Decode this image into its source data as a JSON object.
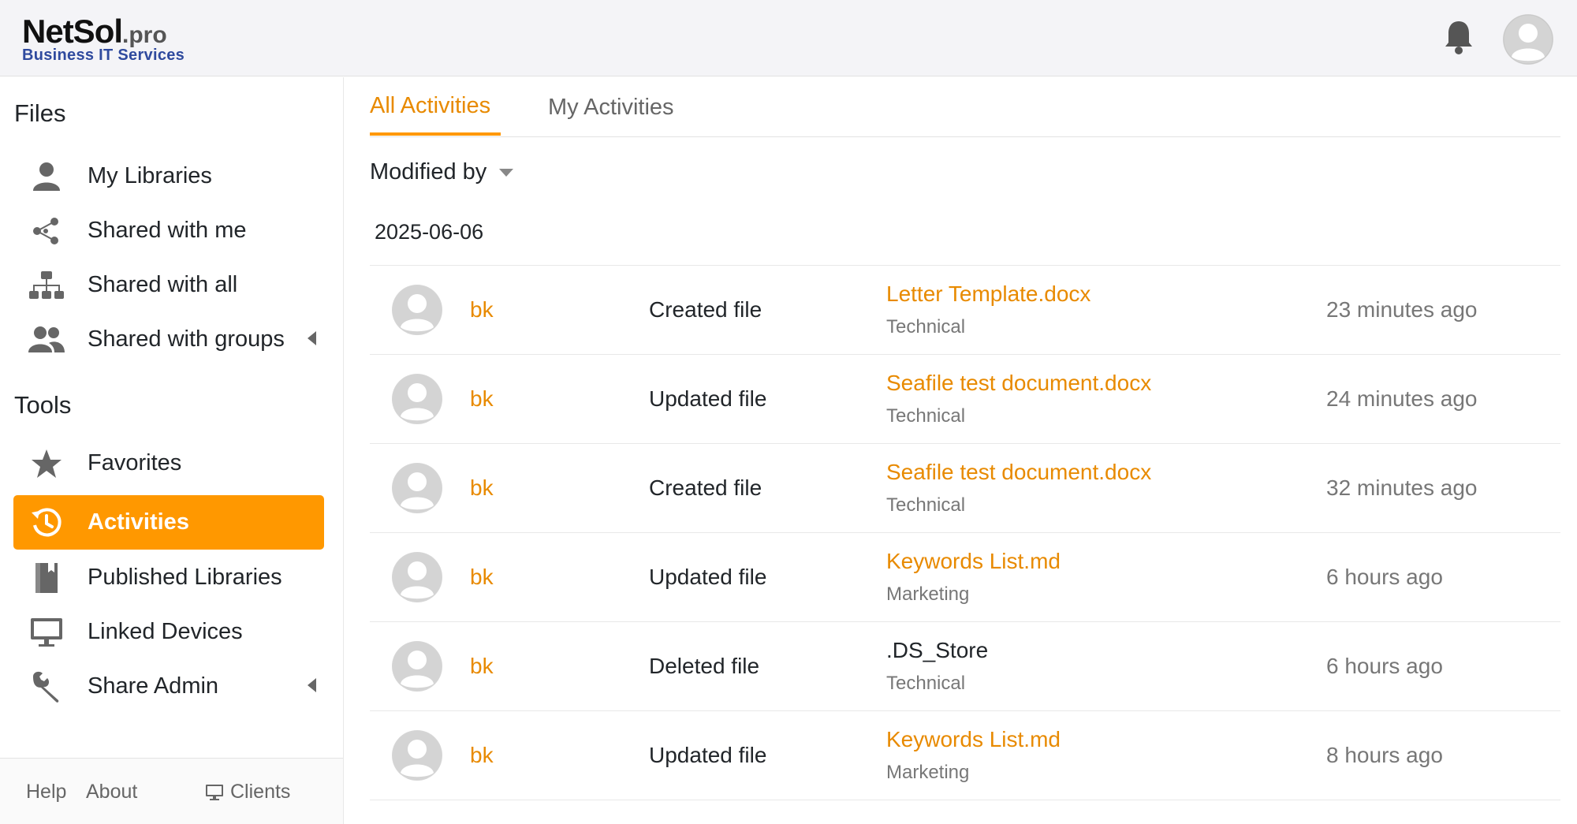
{
  "header": {
    "logo_main": "NetSol",
    "logo_suffix": ".pro",
    "logo_sub": "Business IT Services",
    "notification_icon": "bell-icon",
    "avatar_icon": "user-avatar-icon"
  },
  "sidebar": {
    "files_title": "Files",
    "files_items": [
      {
        "label": "My Libraries",
        "icon": "user-icon"
      },
      {
        "label": "Shared with me",
        "icon": "share-icon"
      },
      {
        "label": "Shared with all",
        "icon": "org-chart-icon"
      },
      {
        "label": "Shared with groups",
        "icon": "group-icon"
      }
    ],
    "tools_title": "Tools",
    "tools_items": [
      {
        "label": "Favorites",
        "icon": "star-icon"
      },
      {
        "label": "Activities",
        "icon": "history-icon"
      },
      {
        "label": "Published Libraries",
        "icon": "book-icon"
      },
      {
        "label": "Linked Devices",
        "icon": "monitor-icon"
      },
      {
        "label": "Share Admin",
        "icon": "wrench-icon"
      }
    ],
    "footer": {
      "help": "Help",
      "about": "About",
      "clients": "Clients"
    }
  },
  "main": {
    "tabs": [
      {
        "label": "All Activities",
        "active": true
      },
      {
        "label": "My Activities",
        "active": false
      }
    ],
    "filter_label": "Modified by",
    "date": "2025-06-06",
    "rows": [
      {
        "user": "bk",
        "op": "Created file",
        "file": "Letter Template.docx",
        "library": "Technical",
        "time": "23 minutes ago",
        "linked": true
      },
      {
        "user": "bk",
        "op": "Updated file",
        "file": "Seafile test document.docx",
        "library": "Technical",
        "time": "24 minutes ago",
        "linked": true
      },
      {
        "user": "bk",
        "op": "Created file",
        "file": "Seafile test document.docx",
        "library": "Technical",
        "time": "32 minutes ago",
        "linked": true
      },
      {
        "user": "bk",
        "op": "Updated file",
        "file": "Keywords List.md",
        "library": "Marketing",
        "time": "6 hours ago",
        "linked": true
      },
      {
        "user": "bk",
        "op": "Deleted file",
        "file": ".DS_Store",
        "library": "Technical",
        "time": "6 hours ago",
        "linked": false
      },
      {
        "user": "bk",
        "op": "Updated file",
        "file": "Keywords List.md",
        "library": "Marketing",
        "time": "8 hours ago",
        "linked": true
      }
    ]
  },
  "colors": {
    "accent": "#ff9800",
    "link": "#e88a00",
    "muted": "#777777"
  }
}
